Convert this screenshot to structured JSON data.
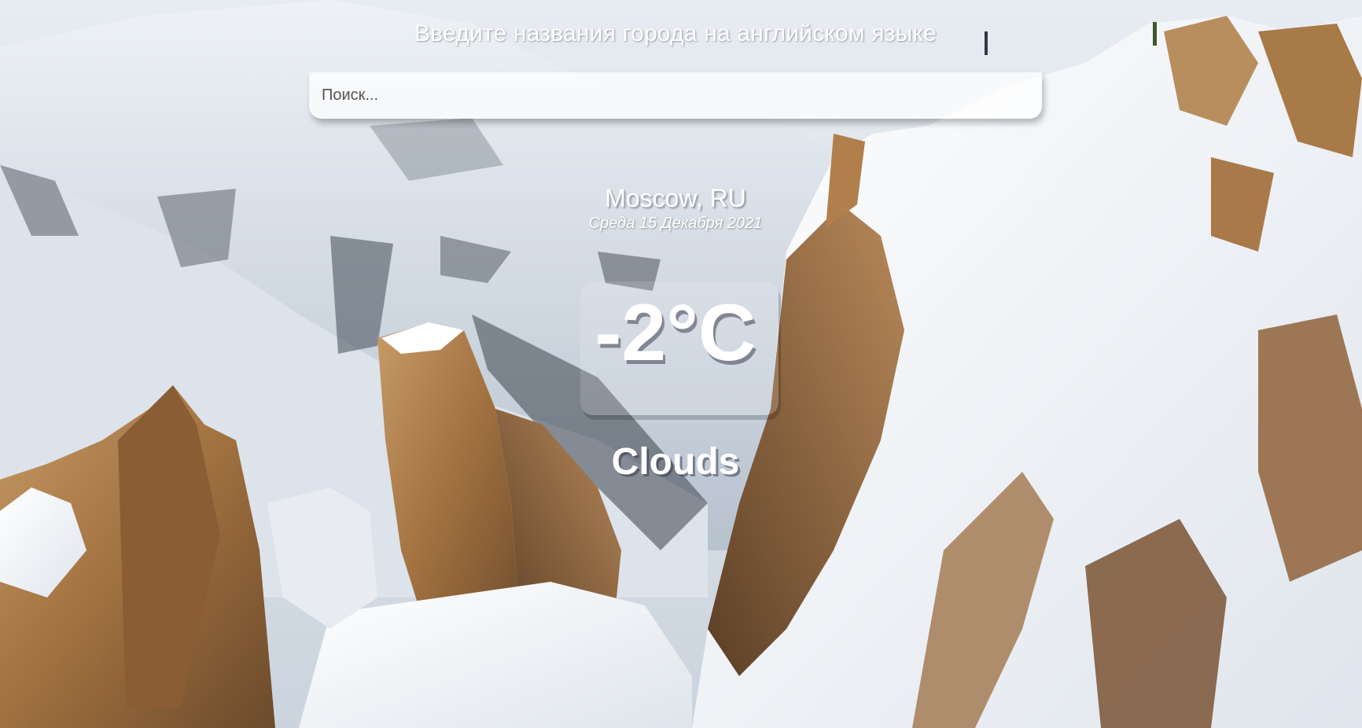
{
  "search": {
    "heading": "Введите названия города на английском языке",
    "placeholder": "Поиск..."
  },
  "location": {
    "city": "Moscow, RU",
    "date": "Среда 15 Декабря 2021"
  },
  "weather": {
    "temperature": "-2°C",
    "condition": "Clouds"
  },
  "colors": {
    "text": "#ffffff",
    "search_background": "rgba(255,255,255,0.72)"
  },
  "background": {
    "image": "snowy-mountain-landscape"
  }
}
